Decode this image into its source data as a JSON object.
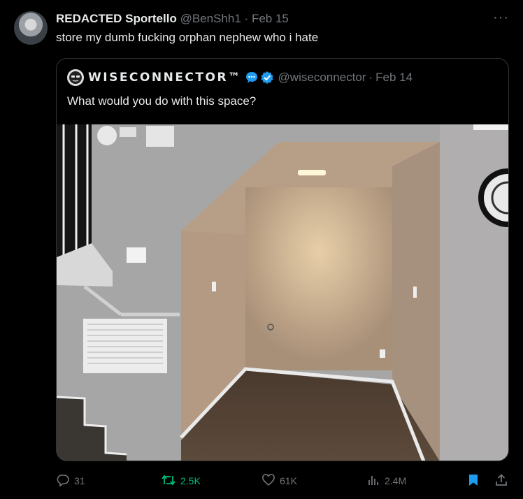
{
  "tweet": {
    "author_name": "REDACTED Sportello",
    "handle": "@BenShh1",
    "dot": "·",
    "date": "Feb 15",
    "text": "store my dumb fucking orphan nephew who i hate"
  },
  "quote": {
    "author_name": "WISECONNECTOR™",
    "handle": "@wiseconnector",
    "dot": "·",
    "date": "Feb 14",
    "text": "What would you do with this space?"
  },
  "actions": {
    "replies": "31",
    "reposts": "2.5K",
    "likes": "61K",
    "views": "2.4M"
  },
  "colors": {
    "background": "#000000",
    "text": "#e7e9ea",
    "muted": "#71767b",
    "repost_active": "#00ba7c",
    "bookmark_active": "#1d9bf0",
    "verified": "#1d9bf0"
  },
  "icons": [
    "more-icon",
    "comment-bubble-icon",
    "verified-badge-icon",
    "reply-icon",
    "repost-icon",
    "like-icon",
    "views-icon",
    "bookmark-icon",
    "share-icon"
  ]
}
